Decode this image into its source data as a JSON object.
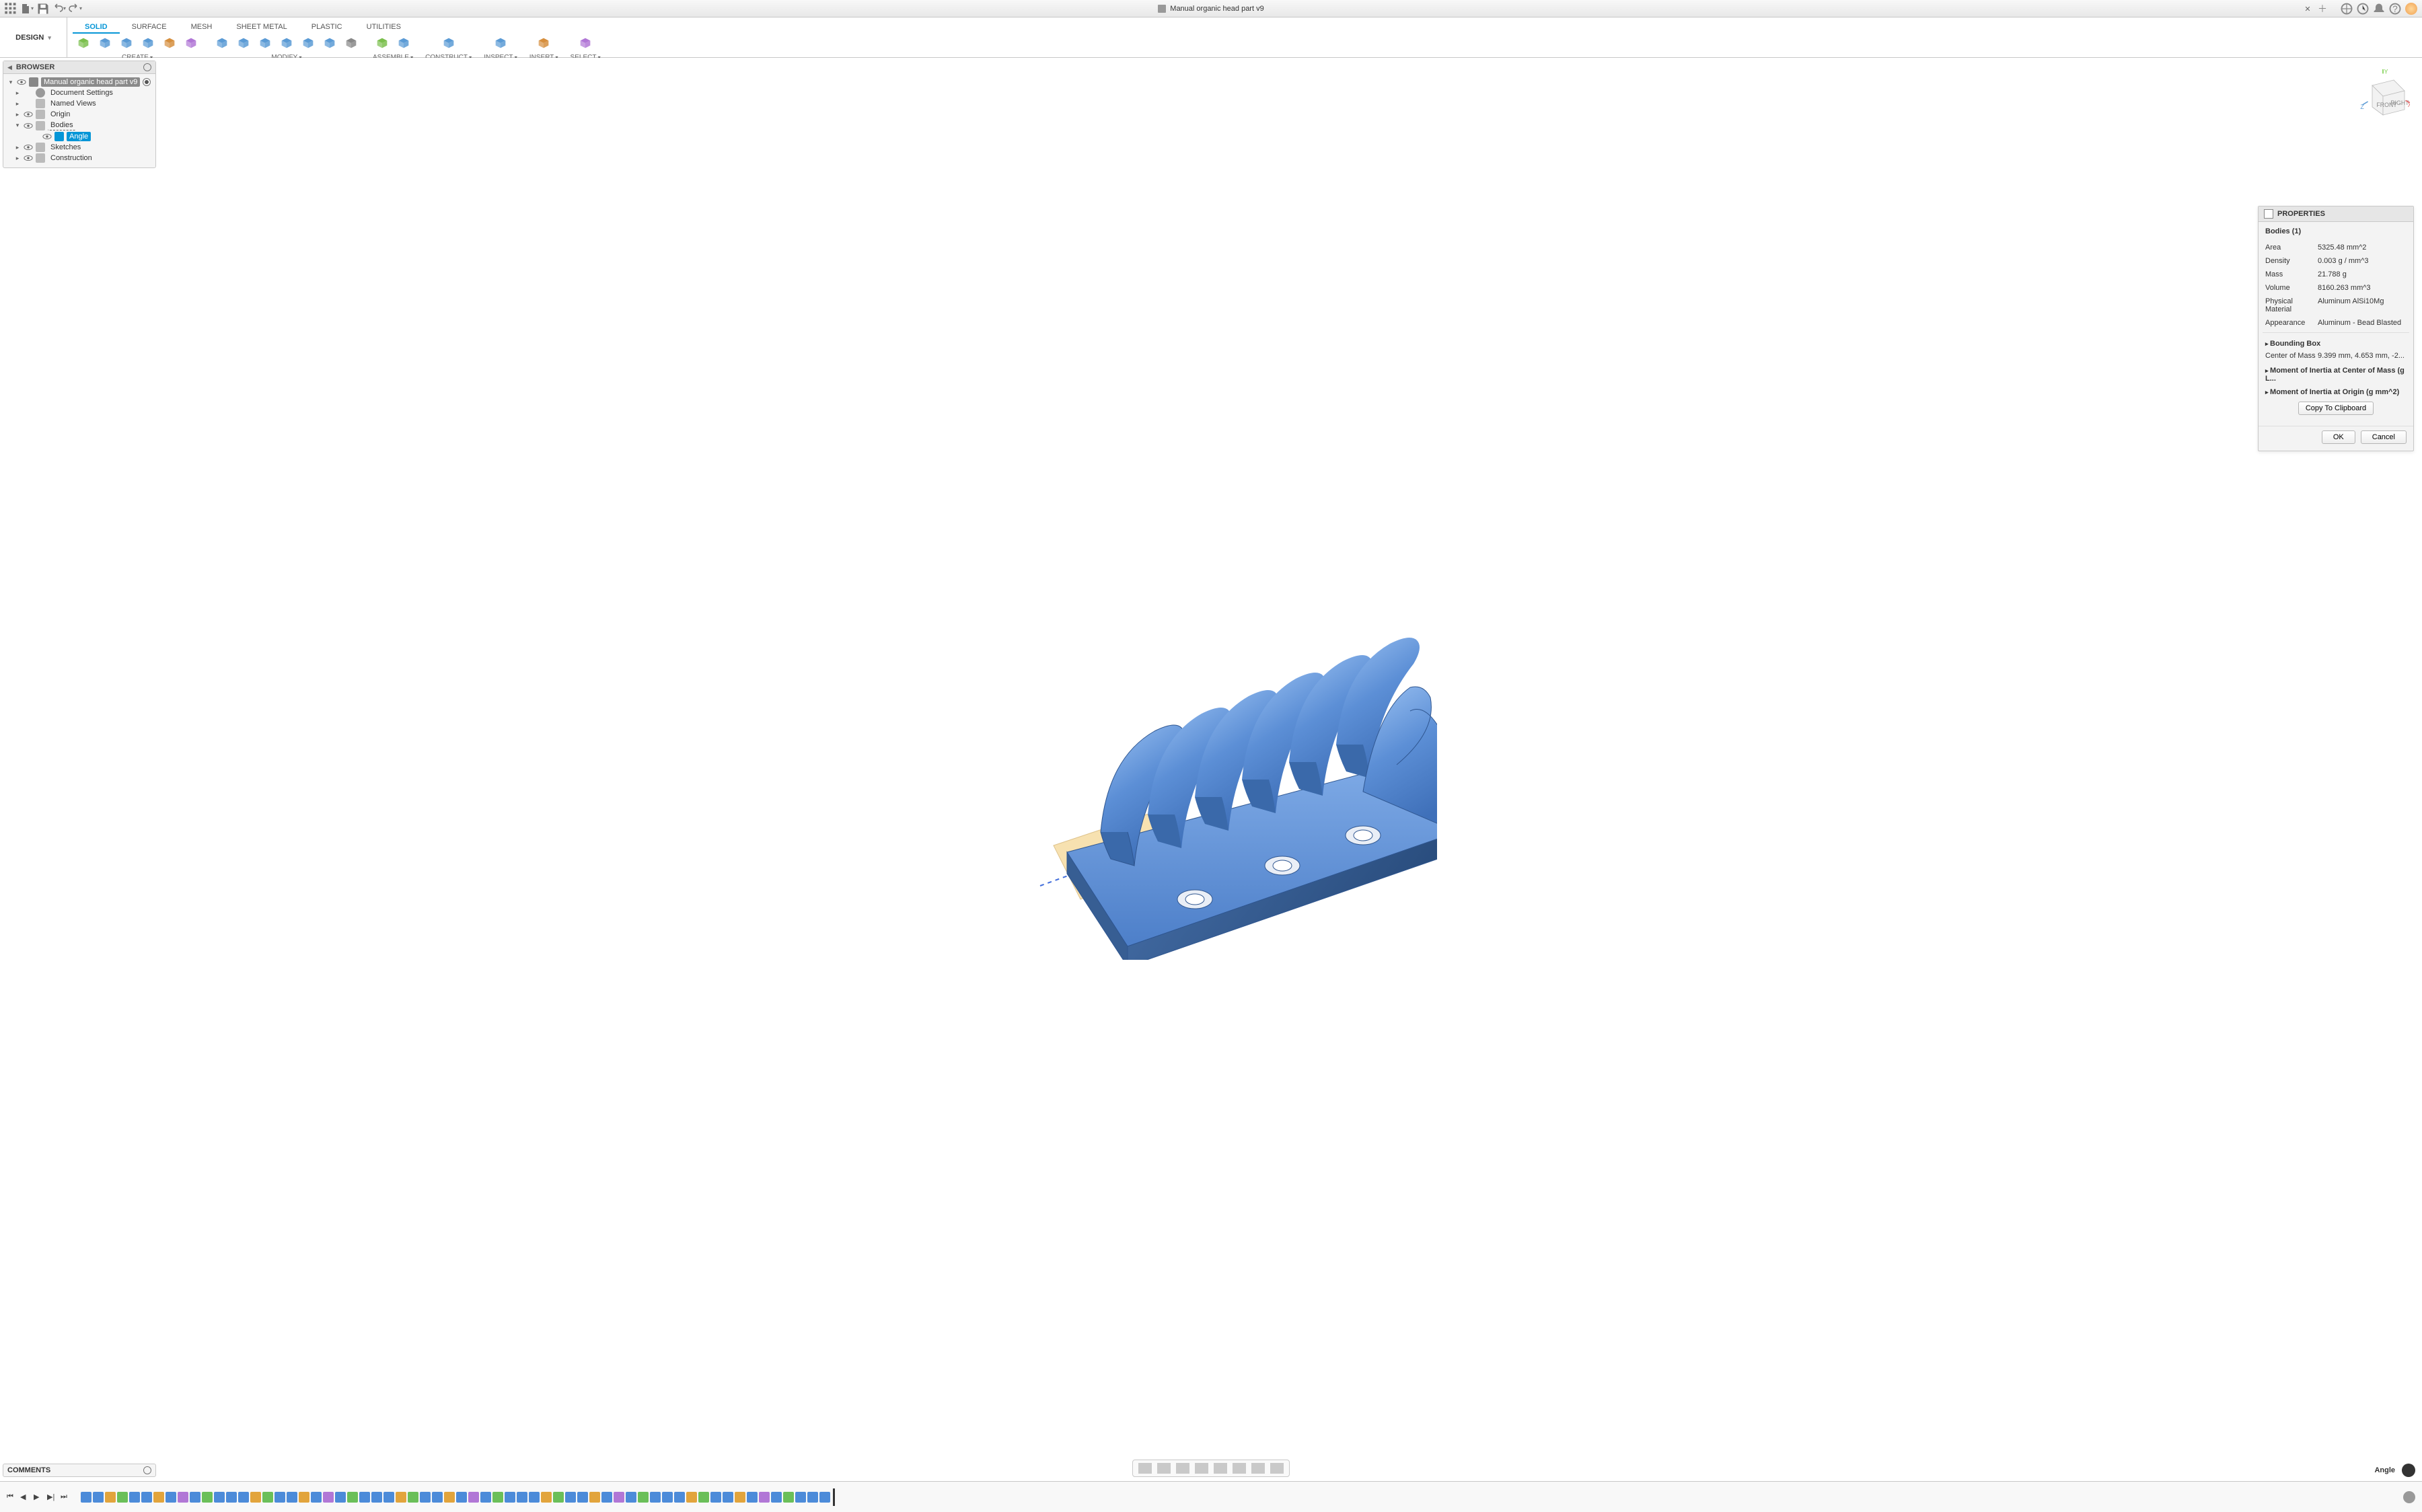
{
  "title": "Manual organic head part v9",
  "design_button": "DESIGN",
  "tabs": [
    "SOLID",
    "SURFACE",
    "MESH",
    "SHEET METAL",
    "PLASTIC",
    "UTILITIES"
  ],
  "active_tab": 0,
  "tool_groups": [
    {
      "label": "CREATE",
      "count": 6,
      "dd": true
    },
    {
      "label": "MODIFY",
      "count": 7,
      "dd": true
    },
    {
      "label": "ASSEMBLE",
      "count": 2,
      "dd": true
    },
    {
      "label": "CONSTRUCT",
      "count": 1,
      "dd": true
    },
    {
      "label": "INSPECT",
      "count": 1,
      "dd": true
    },
    {
      "label": "INSERT",
      "count": 1,
      "dd": true
    },
    {
      "label": "SELECT",
      "count": 1,
      "dd": true
    }
  ],
  "browser": {
    "title": "BROWSER",
    "root": "Manual organic head part v9",
    "items": [
      {
        "label": "Document Settings",
        "icon": "gear",
        "indent": 1,
        "tw": "▸"
      },
      {
        "label": "Named Views",
        "icon": "folder",
        "indent": 1,
        "tw": "▸"
      },
      {
        "label": "Origin",
        "icon": "folder",
        "indent": 1,
        "tw": "▸",
        "eye": true
      },
      {
        "label": "Bodies",
        "icon": "folder",
        "indent": 1,
        "tw": "▾",
        "eye": true,
        "dashed": true
      },
      {
        "label": "Angle",
        "icon": "body",
        "indent": 3,
        "tw": "",
        "eye": true,
        "sel": true
      },
      {
        "label": "Sketches",
        "icon": "folder",
        "indent": 1,
        "tw": "▸",
        "eye": true
      },
      {
        "label": "Construction",
        "icon": "folder",
        "indent": 1,
        "tw": "▸",
        "eye": true
      }
    ]
  },
  "properties": {
    "title": "PROPERTIES",
    "caption": "Bodies (1)",
    "rows": [
      {
        "k": "Area",
        "v": "5325.48 mm^2"
      },
      {
        "k": "Density",
        "v": "0.003 g / mm^3"
      },
      {
        "k": "Mass",
        "v": "21.788 g"
      },
      {
        "k": "Volume",
        "v": "8160.263 mm^3"
      },
      {
        "k": "Physical Material",
        "v": "Aluminum AlSi10Mg"
      },
      {
        "k": "Appearance",
        "v": "Aluminum - Bead Blasted"
      }
    ],
    "bounding": "Bounding Box",
    "com_k": "Center of Mass",
    "com_v": "9.399 mm, 4.653 mm, -2...",
    "moi_com": "Moment of Inertia at Center of Mass   (g L...",
    "moi_origin": "Moment of Inertia at Origin   (g mm^2)",
    "copy": "Copy To Clipboard",
    "ok": "OK",
    "cancel": "Cancel"
  },
  "comments": "COMMENTS",
  "status_label": "Angle",
  "timeline_feature_count": 62,
  "colors": {
    "accent": "#0696d7",
    "body": "#5a8fd8"
  }
}
